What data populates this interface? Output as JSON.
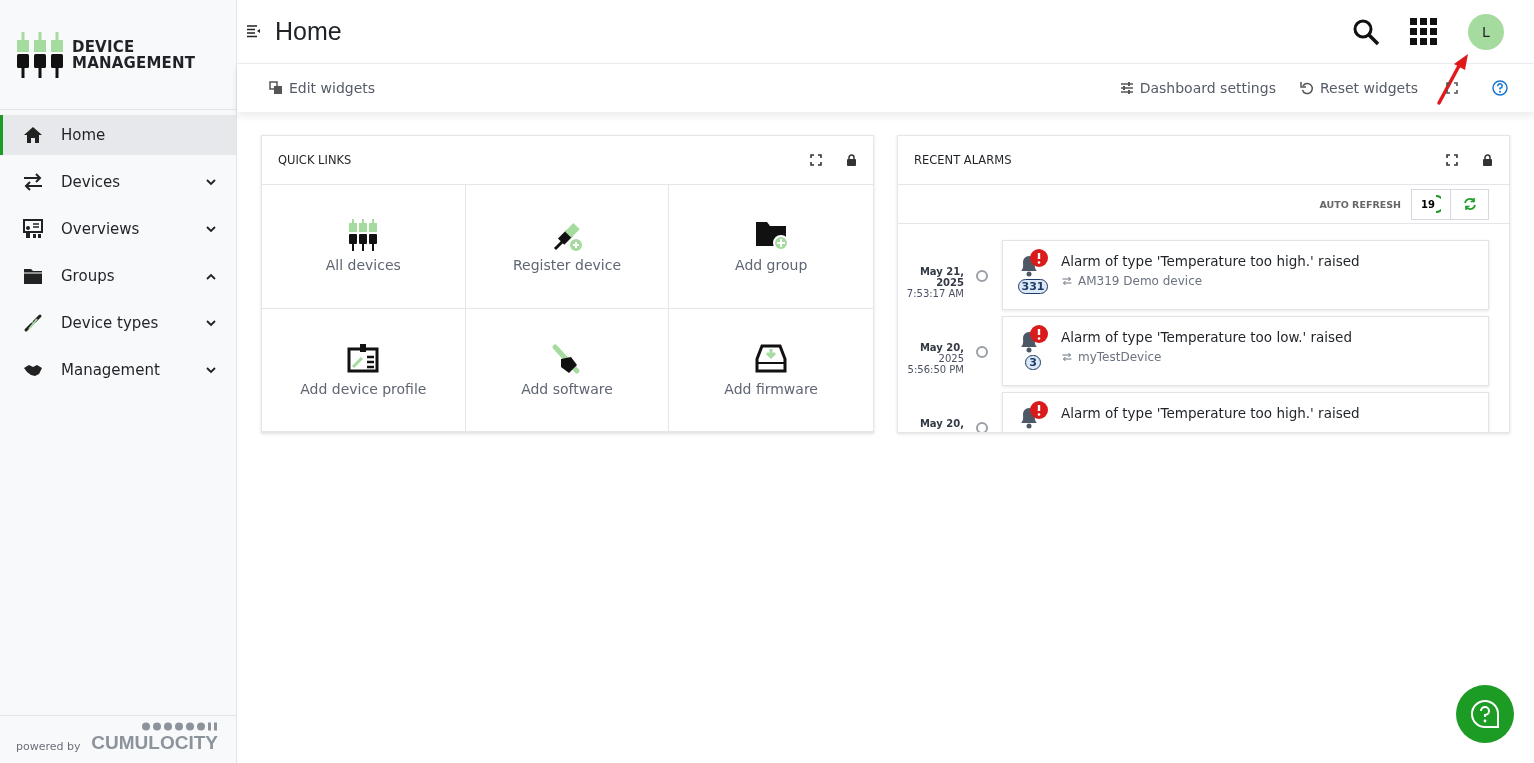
{
  "brand": {
    "line1": "DEVICE",
    "line2": "MANAGEMENT"
  },
  "sidebar": {
    "items": [
      {
        "label": "Home",
        "selected": true
      },
      {
        "label": "Devices",
        "selected": false,
        "expanded": false
      },
      {
        "label": "Overviews",
        "selected": false,
        "expanded": false
      },
      {
        "label": "Groups",
        "selected": false,
        "expanded": true
      },
      {
        "label": "Device types",
        "selected": false,
        "expanded": false
      },
      {
        "label": "Management",
        "selected": false,
        "expanded": false
      }
    ],
    "footer": {
      "text": "powered by",
      "logo": "CUMULOCITY"
    }
  },
  "header": {
    "title": "Home",
    "avatar": "L"
  },
  "toolbar": {
    "left": [
      {
        "label": "Edit widgets"
      }
    ],
    "right": [
      {
        "label": "Dashboard settings"
      },
      {
        "label": "Reset widgets"
      }
    ]
  },
  "quick_links": {
    "title": "QUICK LINKS",
    "links": [
      {
        "label": "All devices"
      },
      {
        "label": "Register device"
      },
      {
        "label": "Add group"
      },
      {
        "label": "Add device profile"
      },
      {
        "label": "Add software"
      },
      {
        "label": "Add firmware"
      }
    ]
  },
  "recent_alarms": {
    "title": "RECENT ALARMS",
    "auto_refresh": "AUTO REFRESH",
    "countdown": "19",
    "alarms": [
      {
        "date": "May 21, 2025",
        "time": "7:53:17 AM",
        "text": "Alarm of type 'Temperature too high.' raised",
        "device": "AM319 Demo device",
        "count": "331"
      },
      {
        "date": "May 20,",
        "time": "2025 5:56:50 PM",
        "text": "Alarm of type 'Temperature too low.' raised",
        "device": "myTestDevice",
        "count": "3"
      },
      {
        "date": "May 20,",
        "text": "Alarm of type 'Temperature too high.' raised"
      }
    ]
  }
}
